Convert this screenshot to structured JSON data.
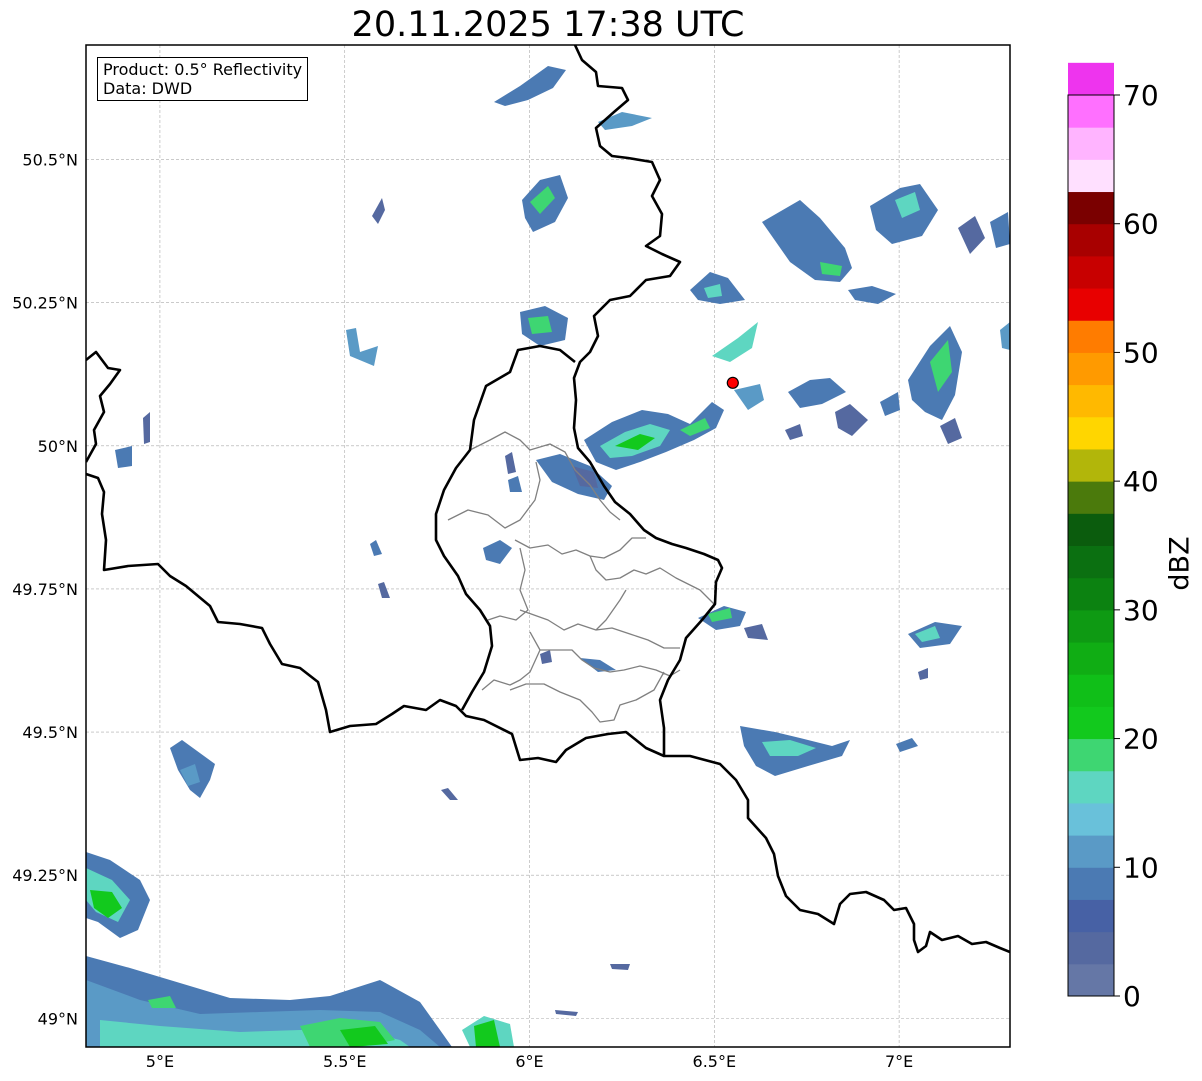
{
  "title": "20.11.2025 17:38 UTC",
  "info_box": {
    "product": "Product: 0.5° Reflectivity",
    "data": "Data: DWD"
  },
  "lat_ticks": [
    "50.5°N",
    "50.25°N",
    "50°N",
    "49.75°N",
    "49.5°N",
    "49.25°N",
    "49°N"
  ],
  "lon_ticks": [
    "5°E",
    "5.5°E",
    "6°E",
    "6.5°E",
    "7°E"
  ],
  "colorbar": {
    "label": "dBZ",
    "tick_labels": [
      "0",
      "10",
      "20",
      "30",
      "40",
      "50",
      "60",
      "70"
    ],
    "min": 0,
    "max": 70,
    "step": 2.5,
    "colors": [
      "#6577a6",
      "#5569a0",
      "#4761a5",
      "#4b7ab3",
      "#5a9ac6",
      "#69c1da",
      "#5ed6c1",
      "#3ed672",
      "#12c91d",
      "#10bf18",
      "#10ad14",
      "#0e9a13",
      "#0c8211",
      "#0b7011",
      "#0b5c0d",
      "#4b7a0c",
      "#b2b60a",
      "#ffd600",
      "#ffb900",
      "#ff9a00",
      "#ff7c00",
      "#e80000",
      "#c80000",
      "#a80000",
      "#7a0000",
      "#ffe0ff",
      "#ffb4ff",
      "#ff70ff",
      "#ee34ee"
    ]
  },
  "marker": {
    "lat": 50.11,
    "lon": 6.55,
    "color": "#ff0000"
  },
  "map_extent": {
    "lon_min": 4.8,
    "lon_max": 7.3,
    "lat_min": 48.95,
    "lat_max": 50.7
  }
}
